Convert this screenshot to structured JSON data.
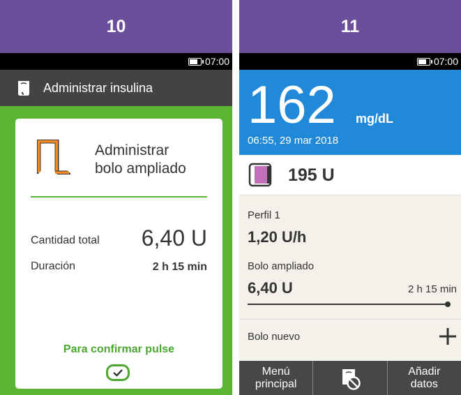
{
  "panel_10": {
    "step": "10",
    "time": "07:00",
    "title": "Administrar insulina",
    "card_title_line1": "Administrar",
    "card_title_line2": "bolo ampliado",
    "total_label": "Cantidad total",
    "total_value": "6,40 U",
    "duration_label": "Duración",
    "duration_value": "2 h 15 min",
    "confirm_text": "Para confirmar pulse",
    "colors": {
      "header": "#6c4f9a",
      "frame": "#5ab532",
      "icon": "#f38a22"
    }
  },
  "panel_11": {
    "step": "11",
    "time": "07:00",
    "bg_value": "162",
    "bg_unit": "mg/dL",
    "bg_datetime": "06:55, 29 mar 2018",
    "reservoir": "195 U",
    "profile_label": "Perfil 1",
    "basal_rate": "1,20 U/h",
    "extended_label": "Bolo ampliado",
    "extended_amount": "6,40 U",
    "extended_duration": "2 h 15 min",
    "extended_progress": 1.0,
    "new_bolus_label": "Bolo nuevo",
    "softkeys": {
      "left_line1": "Menú",
      "left_line2": "principal",
      "middle_icon": "pump-stop-icon",
      "right_line1": "Añadir",
      "right_line2": "datos"
    },
    "colors": {
      "header": "#6c4f9a",
      "bg_block": "#2189d8",
      "reservoir_fill": "#c06fb8"
    }
  }
}
